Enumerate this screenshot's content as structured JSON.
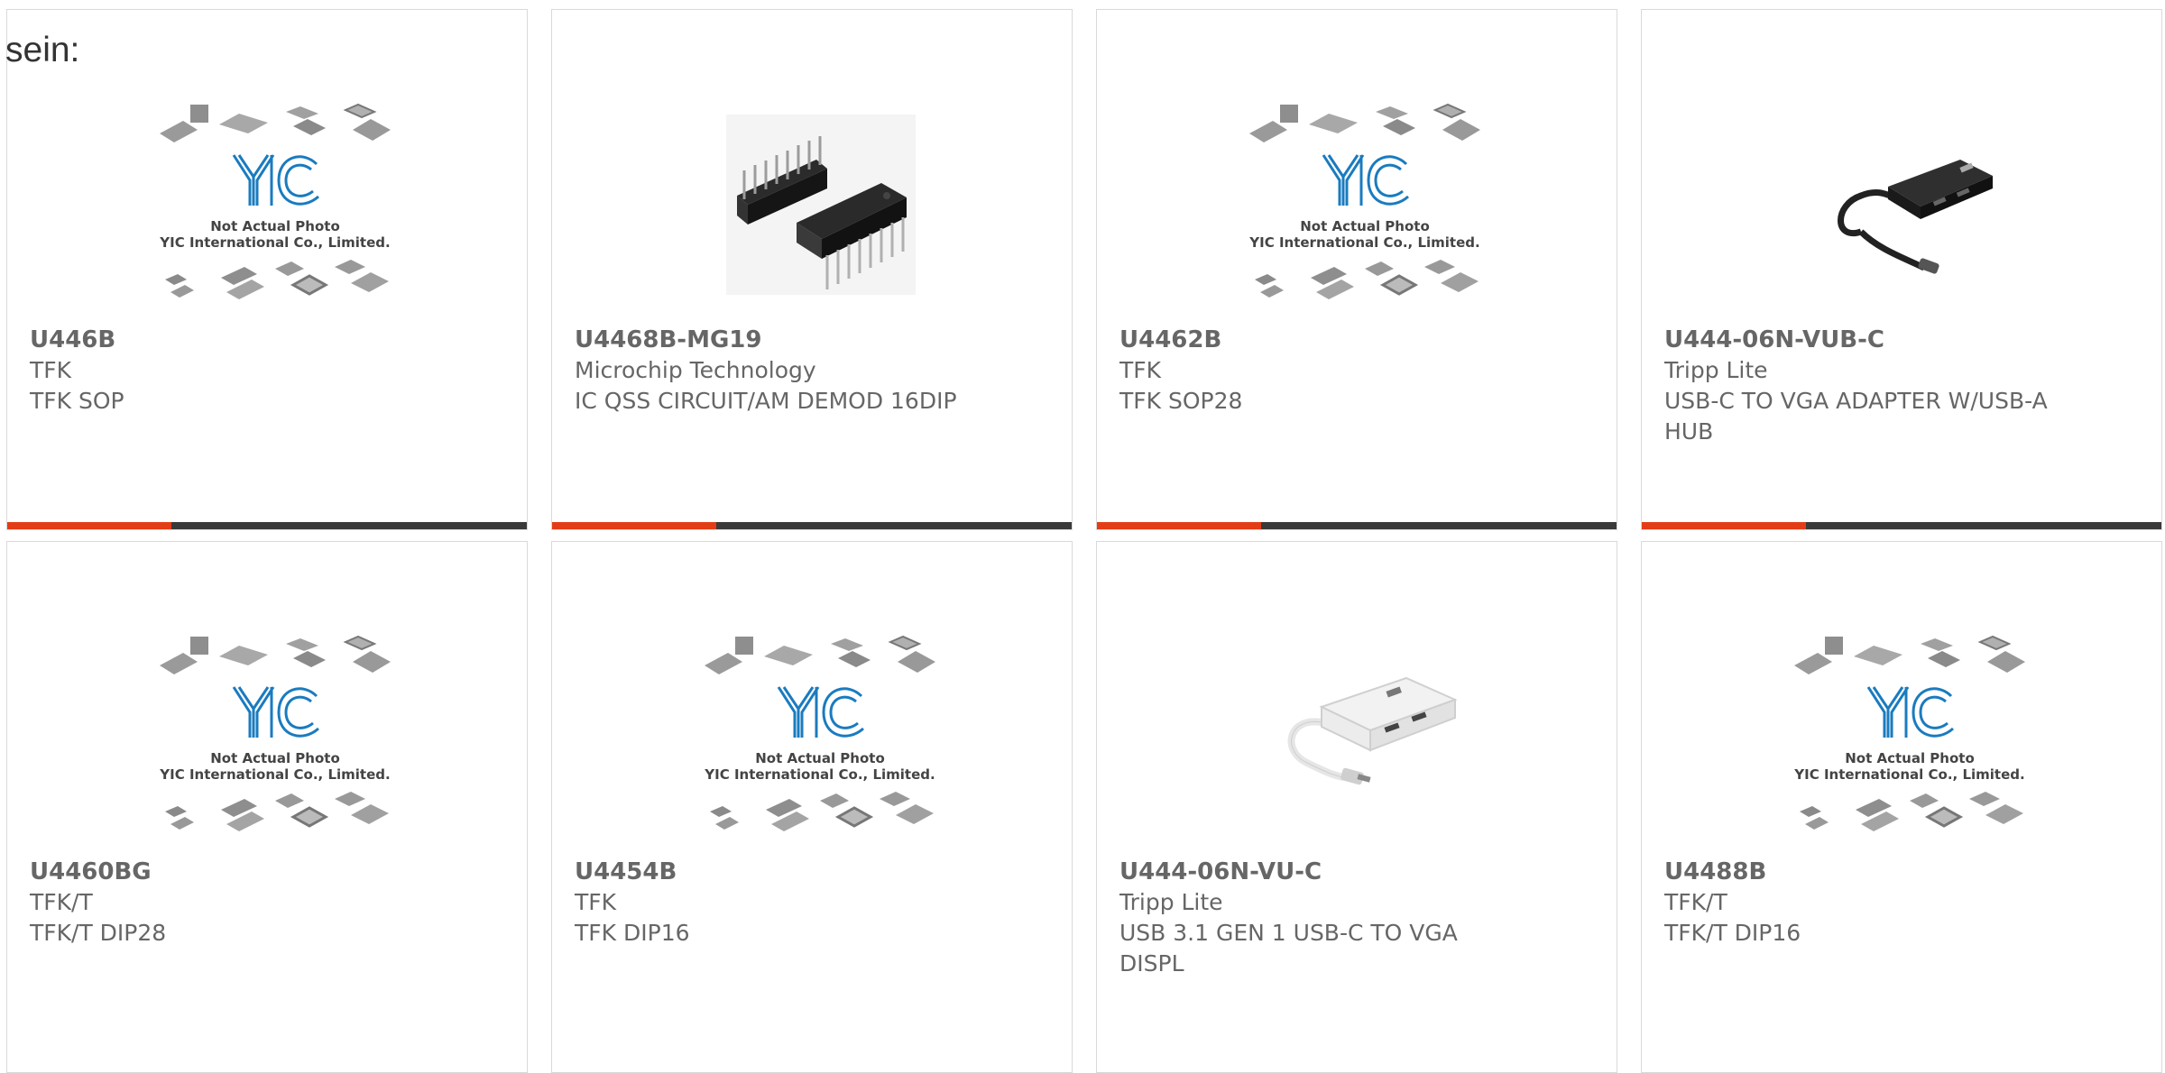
{
  "heading": "sein:",
  "colors": {
    "accent": "#e33d17",
    "bar": "#3a3a3a",
    "border": "#d9d9d9",
    "logo": "#1a7bbf",
    "text": "#666666"
  },
  "placeholder_image": {
    "logo": "YIC",
    "line1": "Not Actual Photo",
    "line2": "YIC International Co., Limited."
  },
  "products": [
    {
      "part": "U446B",
      "maker": "TFK",
      "desc": "TFK SOP",
      "image": "yic-placeholder"
    },
    {
      "part": "U4468B-MG19",
      "maker": "Microchip Technology",
      "desc": "IC QSS CIRCUIT/AM DEMOD 16DIP",
      "image": "dip-ic-photo"
    },
    {
      "part": "U4462B",
      "maker": "TFK",
      "desc": "TFK SOP28",
      "image": "yic-placeholder"
    },
    {
      "part": "U444-06N-VUB-C",
      "maker": "Tripp Lite",
      "desc": "USB-C TO VGA ADAPTER W/USB-A HUB",
      "image": "black-usb-adapter-photo"
    },
    {
      "part": "U4460BG",
      "maker": "TFK/T",
      "desc": "TFK/T DIP28",
      "image": "yic-placeholder"
    },
    {
      "part": "U4454B",
      "maker": "TFK",
      "desc": "TFK DIP16",
      "image": "yic-placeholder"
    },
    {
      "part": "U444-06N-VU-C",
      "maker": "Tripp Lite",
      "desc": "USB 3.1 GEN 1 USB-C TO VGA DISPL",
      "image": "white-usb-adapter-photo"
    },
    {
      "part": "U4488B",
      "maker": "TFK/T",
      "desc": "TFK/T DIP16",
      "image": "yic-placeholder"
    }
  ]
}
